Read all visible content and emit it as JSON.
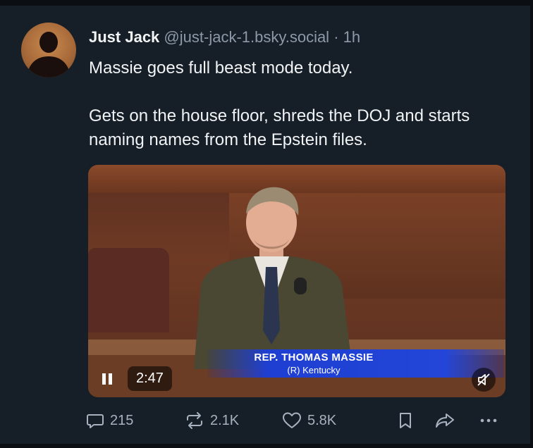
{
  "post": {
    "author_name": "Just Jack",
    "author_handle": "@just-jack-1.bsky.social",
    "separator": "·",
    "time": "1h",
    "text_line1": "Massie goes full beast mode today.",
    "text_line2": "Gets on the house floor, shreds the DOJ and starts naming names from the Epstein files.",
    "avatar_icon": "person-silhouette-icon"
  },
  "video": {
    "lower_third_title": "REP. THOMAS MASSIE",
    "lower_third_subtitle": "(R) Kentucky",
    "duration": "2:47",
    "pause_icon": "pause-icon",
    "mute_icon": "speaker-muted-icon"
  },
  "actions": {
    "replies": "215",
    "reposts": "2.1K",
    "likes": "5.8K",
    "reply_icon": "speech-bubble-icon",
    "repost_icon": "repost-arrows-icon",
    "like_icon": "heart-icon",
    "bookmark_icon": "bookmark-icon",
    "share_icon": "share-arrow-icon",
    "more_icon": "ellipsis-icon"
  },
  "colors": {
    "background": "#161e27",
    "text": "#f1f3f5",
    "muted": "#8c99a8",
    "lower_third_blue": "#2346d8"
  }
}
